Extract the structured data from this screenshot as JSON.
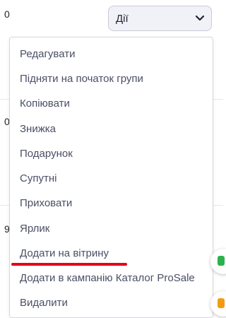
{
  "background": {
    "row_numbers": [
      "0",
      "0",
      "9"
    ]
  },
  "actions_select": {
    "label": "Дії",
    "icon": "chevron-down-icon"
  },
  "menu": {
    "items": [
      "Редагувати",
      "Підняти на початок групи",
      "Копіювати",
      "Знижка",
      "Подарунок",
      "Супутні",
      "Приховати",
      "Ярлик",
      "Додати на вітрину",
      "Додати в кампанію Каталог ProSale",
      "Видалити"
    ],
    "highlighted_item_index": 8,
    "highlight_color": "#e3001b"
  },
  "side_buttons": {
    "top_icon": "green-chat-icon",
    "top_color": "#2bb24c",
    "bottom_icon": "orange-lock-icon",
    "bottom_color": "#f39c12"
  },
  "colors": {
    "menu_text": "#4a4f63",
    "select_bg": "#f1f2f8",
    "select_border": "#c8cad6"
  }
}
